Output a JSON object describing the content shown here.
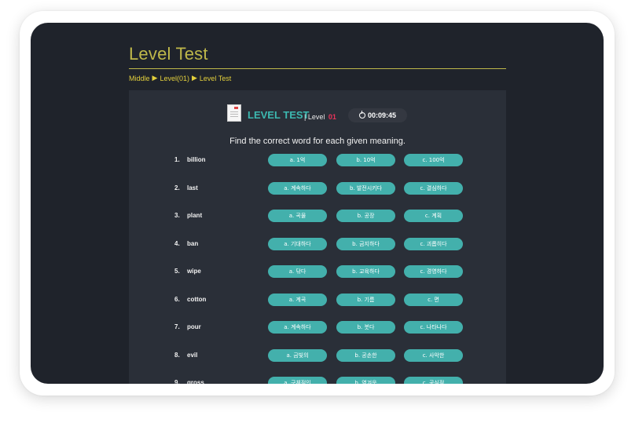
{
  "page": {
    "title": "Level Test",
    "breadcrumb": [
      "Middle",
      "Level(01)",
      "Level Test"
    ]
  },
  "test": {
    "heading": "LEVEL TEST",
    "level_label": "| Level",
    "level_number": "01",
    "timer": "00:09:45",
    "instruction": "Find the correct word for each given meaning."
  },
  "questions": [
    {
      "num": "1.",
      "word": "billion",
      "options": [
        "a. 1억",
        "b. 10억",
        "c. 100억"
      ]
    },
    {
      "num": "2.",
      "word": "last",
      "options": [
        "a. 계속하다",
        "b. 발전시키다",
        "c. 결심하다"
      ]
    },
    {
      "num": "3.",
      "word": "plant",
      "options": [
        "a. 곡물",
        "b. 공장",
        "c. 계획"
      ]
    },
    {
      "num": "4.",
      "word": "ban",
      "options": [
        "a. 기대하다",
        "b. 금지하다",
        "c. 괴롭히다"
      ]
    },
    {
      "num": "5.",
      "word": "wipe",
      "options": [
        "a. 닦다",
        "b. 교육하다",
        "c. 경영하다"
      ]
    },
    {
      "num": "6.",
      "word": "cotton",
      "options": [
        "a. 계곡",
        "b. 기름",
        "c. 면"
      ]
    },
    {
      "num": "7.",
      "word": "pour",
      "options": [
        "a. 계속하다",
        "b. 붓다",
        "c. 나타나다"
      ]
    },
    {
      "num": "8.",
      "word": "evil",
      "options": [
        "a. 금빛의",
        "b. 공손한",
        "c. 사악한"
      ]
    },
    {
      "num": "9.",
      "word": "gross",
      "options": [
        "a. 구체적인",
        "b. 역겨운",
        "c. 공식적"
      ]
    }
  ],
  "colors": {
    "background": "#1f232b",
    "panel": "#2a2f38",
    "accent_teal": "#43b0ac",
    "title_gold": "#bfb84a",
    "level_red": "#e8335a"
  },
  "icons": [
    "document-icon",
    "clock-icon",
    "triangle-right-icon"
  ]
}
